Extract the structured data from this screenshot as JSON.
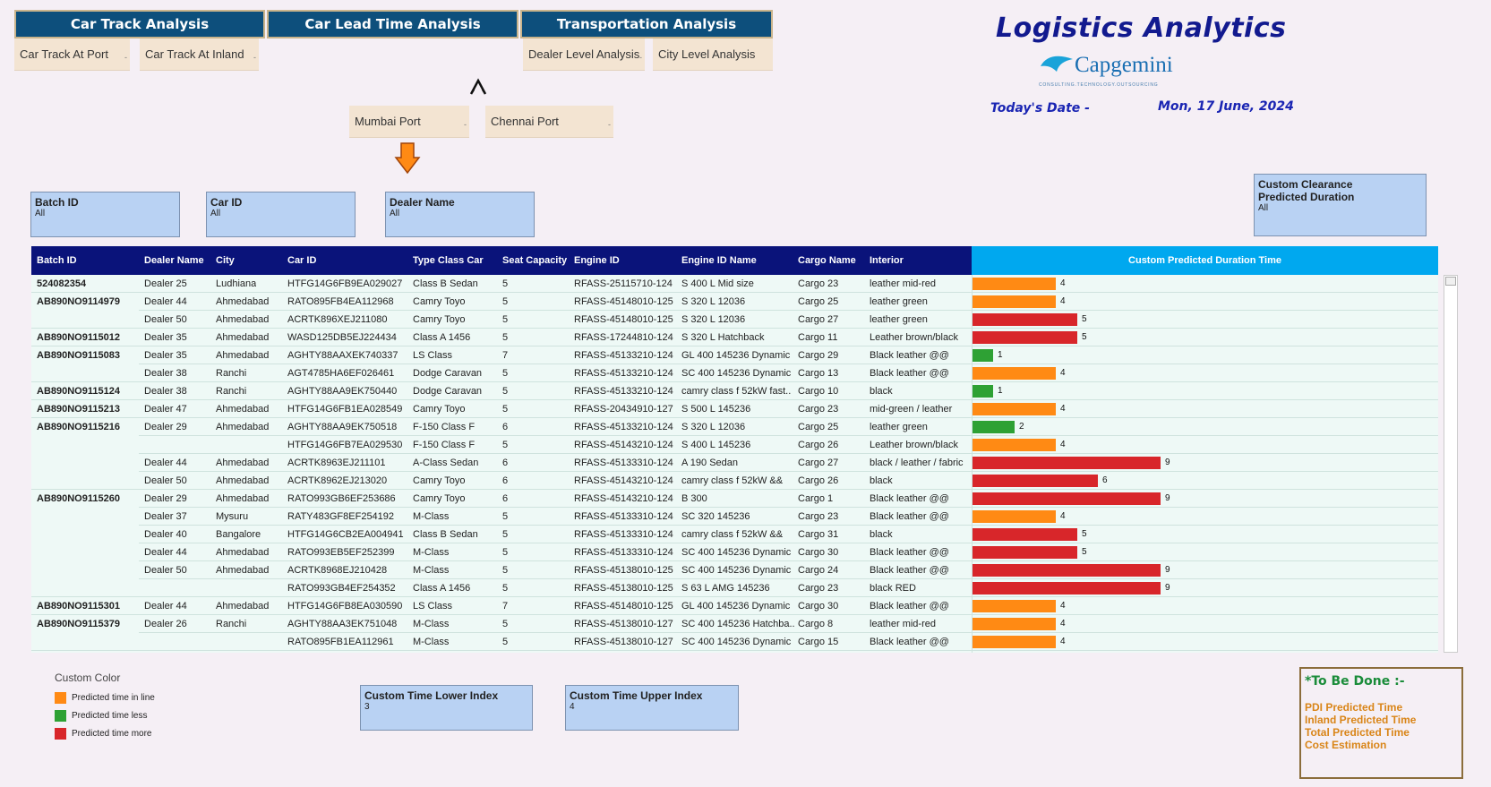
{
  "nav": {
    "tabs": [
      "Car Track Analysis",
      "Car Lead Time Analysis",
      "Transportation Analysis"
    ],
    "car_track_subtabs": [
      "Car Track At Port",
      "Car Track At Inland"
    ],
    "transport_subtabs": [
      "Dealer Level Analysis",
      "City Level Analysis"
    ],
    "port_subtabs": [
      "Mumbai Port",
      "Chennai Port"
    ]
  },
  "header": {
    "title": "Logistics Analytics",
    "logo_text": "Capgemini",
    "logo_tagline": "CONSULTING.TECHNOLOGY.OUTSOURCING",
    "date_label": "Today's Date -",
    "date_value": "Mon, 17 June, 2024"
  },
  "filters": {
    "batch_id": {
      "label": "Batch ID",
      "value": "All"
    },
    "car_id": {
      "label": "Car ID",
      "value": "All"
    },
    "dealer_name": {
      "label": "Dealer Name",
      "value": "All"
    },
    "custom_clearance": {
      "label_line1": "Custom Clearance",
      "label_line2": "Predicted Duration",
      "value": "All"
    },
    "lower_index": {
      "label": "Custom Time Lower Index",
      "value": "3"
    },
    "upper_index": {
      "label": "Custom Time Upper Index",
      "value": "4"
    }
  },
  "table": {
    "columns": [
      "Batch ID",
      "Dealer Name",
      "City",
      "Car ID",
      "Type Class Car",
      "Seat Capacity",
      "Engine ID",
      "Engine ID Name",
      "Cargo Name",
      "Interior"
    ],
    "bar_column": "Custom Predicted Duration Time",
    "rows": [
      {
        "batch": "524082354",
        "dealer": "Dealer 25",
        "city": "Ludhiana",
        "car": "HTFG14G6FB9EA029027",
        "type": "Class B Sedan",
        "seat": "5",
        "engine": "RFASS-25115710-124",
        "engine_name": "S 400 L Mid size",
        "cargo": "Cargo 23",
        "interior": "leather mid-red",
        "duration": 4,
        "status": "inline"
      },
      {
        "batch": "AB890NO9114979",
        "dealer": "Dealer 44",
        "city": "Ahmedabad",
        "car": "RATO895FB4EA112968",
        "type": "Camry Toyo",
        "seat": "5",
        "engine": "RFASS-45148010-125",
        "engine_name": "S 320 L 12036",
        "cargo": "Cargo 25",
        "interior": "leather green",
        "duration": 4,
        "status": "inline"
      },
      {
        "batch": "",
        "dealer": "Dealer 50",
        "city": "Ahmedabad",
        "car": "ACRTK896XEJ211080",
        "type": "Camry Toyo",
        "seat": "5",
        "engine": "RFASS-45148010-125",
        "engine_name": "S 320 L 12036",
        "cargo": "Cargo 27",
        "interior": "leather green",
        "duration": 5,
        "status": "more"
      },
      {
        "batch": "AB890NO9115012",
        "dealer": "Dealer 35",
        "city": "Ahmedabad",
        "car": "WASD125DB5EJ224434",
        "type": "Class A 1456",
        "seat": "5",
        "engine": "RFASS-17244810-124",
        "engine_name": "S 320 L Hatchback",
        "cargo": "Cargo 11",
        "interior": "Leather brown/black",
        "duration": 5,
        "status": "more"
      },
      {
        "batch": "AB890NO9115083",
        "dealer": "Dealer 35",
        "city": "Ahmedabad",
        "car": "AGHTY88AAXEK740337",
        "type": "LS Class",
        "seat": "7",
        "engine": "RFASS-45133210-124",
        "engine_name": "GL 400 145236 Dynamic",
        "cargo": "Cargo 29",
        "interior": "Black leather @@",
        "duration": 1,
        "status": "less"
      },
      {
        "batch": "",
        "dealer": "Dealer 38",
        "city": "Ranchi",
        "car": "AGT4785HA6EF026461",
        "type": "Dodge Caravan",
        "seat": "5",
        "engine": "RFASS-45133210-124",
        "engine_name": "SC 400 145236 Dynamic",
        "cargo": "Cargo 13",
        "interior": "Black leather @@",
        "duration": 4,
        "status": "inline"
      },
      {
        "batch": "AB890NO9115124",
        "dealer": "Dealer 38",
        "city": "Ranchi",
        "car": "AGHTY88AA9EK750440",
        "type": "Dodge Caravan",
        "seat": "5",
        "engine": "RFASS-45133210-124",
        "engine_name": "camry class f 52kW  fast..",
        "cargo": "Cargo 10",
        "interior": "black",
        "duration": 1,
        "status": "less"
      },
      {
        "batch": "AB890NO9115213",
        "dealer": "Dealer 47",
        "city": "Ahmedabad",
        "car": "HTFG14G6FB1EA028549",
        "type": "Camry Toyo",
        "seat": "5",
        "engine": "RFASS-20434910-127",
        "engine_name": "S 500 L 145236",
        "cargo": "Cargo 23",
        "interior": "mid-green / leather",
        "duration": 4,
        "status": "inline"
      },
      {
        "batch": "AB890NO9115216",
        "dealer": "Dealer 29",
        "city": "Ahmedabad",
        "car": "AGHTY88AA9EK750518",
        "type": "F-150 Class F",
        "seat": "6",
        "engine": "RFASS-45133210-124",
        "engine_name": "S 320 L 12036",
        "cargo": "Cargo 25",
        "interior": "leather green",
        "duration": 2,
        "status": "less"
      },
      {
        "batch": "",
        "dealer": "",
        "city": "",
        "car": "HTFG14G6FB7EA029530",
        "type": "F-150 Class F",
        "seat": "5",
        "engine": "RFASS-45143210-124",
        "engine_name": "S 400 L 145236",
        "cargo": "Cargo 26",
        "interior": "Leather brown/black",
        "duration": 4,
        "status": "inline"
      },
      {
        "batch": "",
        "dealer": "Dealer 44",
        "city": "Ahmedabad",
        "car": "ACRTK8963EJ211101",
        "type": " A-Class Sedan",
        "seat": "6",
        "engine": "RFASS-45133310-124",
        "engine_name": "A 190 Sedan",
        "cargo": "Cargo 27",
        "interior": "black / leather / fabric",
        "duration": 9,
        "status": "more"
      },
      {
        "batch": "",
        "dealer": "Dealer 50",
        "city": "Ahmedabad",
        "car": "ACRTK8962EJ213020",
        "type": "Camry Toyo",
        "seat": "6",
        "engine": "RFASS-45143210-124",
        "engine_name": "camry class f 52kW  &&",
        "cargo": "Cargo 26",
        "interior": "black",
        "duration": 6,
        "status": "more"
      },
      {
        "batch": "AB890NO9115260",
        "dealer": "Dealer 29",
        "city": "Ahmedabad",
        "car": "RATO993GB6EF253686",
        "type": "Camry Toyo",
        "seat": "6",
        "engine": "RFASS-45143210-124",
        "engine_name": "B 300",
        "cargo": "Cargo 1",
        "interior": "Black leather @@",
        "duration": 9,
        "status": "more"
      },
      {
        "batch": "",
        "dealer": "Dealer 37",
        "city": "Mysuru",
        "car": "RATY483GF8EF254192",
        "type": " M-Class",
        "seat": "5",
        "engine": "RFASS-45133310-124",
        "engine_name": "SC 320 145236",
        "cargo": "Cargo 23",
        "interior": "Black leather @@",
        "duration": 4,
        "status": "inline"
      },
      {
        "batch": "",
        "dealer": "Dealer 40",
        "city": "Bangalore",
        "car": "HTFG14G6CB2EA004941",
        "type": "Class B Sedan",
        "seat": "5",
        "engine": "RFASS-45133310-124",
        "engine_name": "camry class f 52kW  &&",
        "cargo": "Cargo 31",
        "interior": "black",
        "duration": 5,
        "status": "more"
      },
      {
        "batch": "",
        "dealer": "Dealer 44",
        "city": "Ahmedabad",
        "car": "RATO993EB5EF252399",
        "type": " M-Class",
        "seat": "5",
        "engine": "RFASS-45133310-124",
        "engine_name": "SC 400 145236 Dynamic",
        "cargo": "Cargo 30",
        "interior": "Black leather @@",
        "duration": 5,
        "status": "more"
      },
      {
        "batch": "",
        "dealer": "Dealer 50",
        "city": "Ahmedabad",
        "car": "ACRTK8968EJ210428",
        "type": " M-Class",
        "seat": "5",
        "engine": "RFASS-45138010-125",
        "engine_name": "SC 400 145236 Dynamic",
        "cargo": "Cargo 24",
        "interior": "Black leather @@",
        "duration": 9,
        "status": "more"
      },
      {
        "batch": "",
        "dealer": "",
        "city": "",
        "car": "RATO993GB4EF254352",
        "type": "Class A 1456",
        "seat": "5",
        "engine": "RFASS-45138010-125",
        "engine_name": "S 63 L AMG 145236",
        "cargo": "Cargo 23",
        "interior": " black RED",
        "duration": 9,
        "status": "more"
      },
      {
        "batch": "AB890NO9115301",
        "dealer": "Dealer 44",
        "city": "Ahmedabad",
        "car": "HTFG14G6FB8EA030590",
        "type": "LS Class",
        "seat": "7",
        "engine": "RFASS-45148010-125",
        "engine_name": "GL 400 145236 Dynamic",
        "cargo": "Cargo 30",
        "interior": "Black leather @@",
        "duration": 4,
        "status": "inline"
      },
      {
        "batch": "AB890NO9115379",
        "dealer": "Dealer 26",
        "city": "Ranchi",
        "car": "AGHTY88AA3EK751048",
        "type": " M-Class",
        "seat": "5",
        "engine": "RFASS-45138010-127",
        "engine_name": "SC 400 145236 Hatchba..",
        "cargo": "Cargo 8",
        "interior": "leather mid-red",
        "duration": 4,
        "status": "inline"
      },
      {
        "batch": "",
        "dealer": "",
        "city": "",
        "car": "RATO895FB1EA112961",
        "type": " M-Class",
        "seat": "5",
        "engine": "RFASS-45138010-127",
        "engine_name": "SC 400 145236 Dynamic",
        "cargo": "Cargo 15",
        "interior": "Black leather @@",
        "duration": 4,
        "status": "inline"
      }
    ]
  },
  "legend": {
    "title": "Custom Color",
    "items": [
      {
        "label": "Predicted time in line",
        "color": "#ff8a14"
      },
      {
        "label": "Predicted time less",
        "color": "#2ea134"
      },
      {
        "label": "Predicted time more",
        "color": "#d8262a"
      }
    ]
  },
  "todo": {
    "title": "*To Be Done :-",
    "items": [
      "PDI Predicted Time",
      "Inland Predicted Time",
      "Total Predicted Time",
      "Cost Estimation"
    ]
  },
  "colors": {
    "inline": "#ff8a14",
    "less": "#2ea134",
    "more": "#d8262a",
    "header": "#0a137a",
    "header_accent": "#00a8ef"
  }
}
